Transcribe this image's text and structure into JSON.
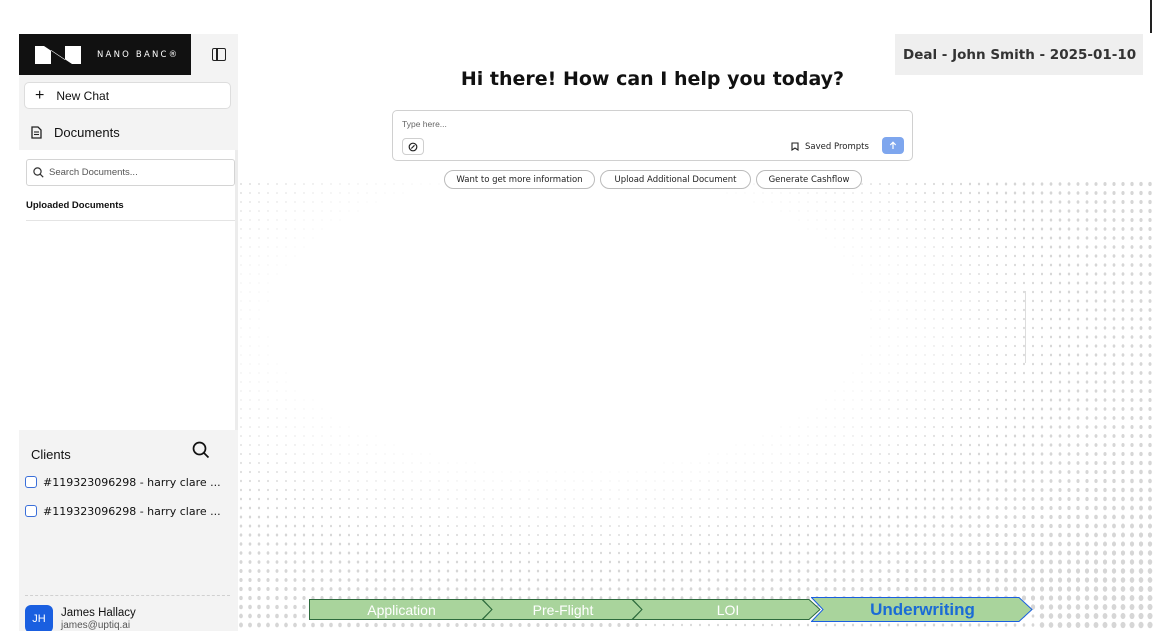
{
  "sidebar": {
    "logo_text": "NANO BANC®",
    "new_chat_label": "New Chat",
    "documents_label": "Documents",
    "doc_search_placeholder": "Search Documents...",
    "uploaded_title": "Uploaded Documents",
    "clients_title": "Clients",
    "clients": [
      "#119323096298 - harry clare ...",
      "#119323096298 - harry clare ..."
    ],
    "user": {
      "initials": "JH",
      "name": "James Hallacy",
      "email": "james@uptiq.ai"
    }
  },
  "main": {
    "deal_title": "Deal - John Smith - 2025-01-10",
    "greeting": "Hi there! How can I help you today?",
    "prompt_placeholder": "Type here...",
    "saved_prompts_label": "Saved Prompts",
    "suggestions": [
      "Want to get more information",
      "Upload Additional Document",
      "Generate Cashflow"
    ]
  },
  "stepper": {
    "steps": [
      "Application",
      "Pre-Flight",
      "LOI",
      "Underwriting"
    ],
    "active": "Underwriting"
  },
  "colors": {
    "accent": "#1a5fe0",
    "send_button": "#7ea6ee",
    "step_fill": "#a9d49c",
    "step_stroke": "#2e6b3d",
    "active_step_text": "#1a6bd6"
  }
}
